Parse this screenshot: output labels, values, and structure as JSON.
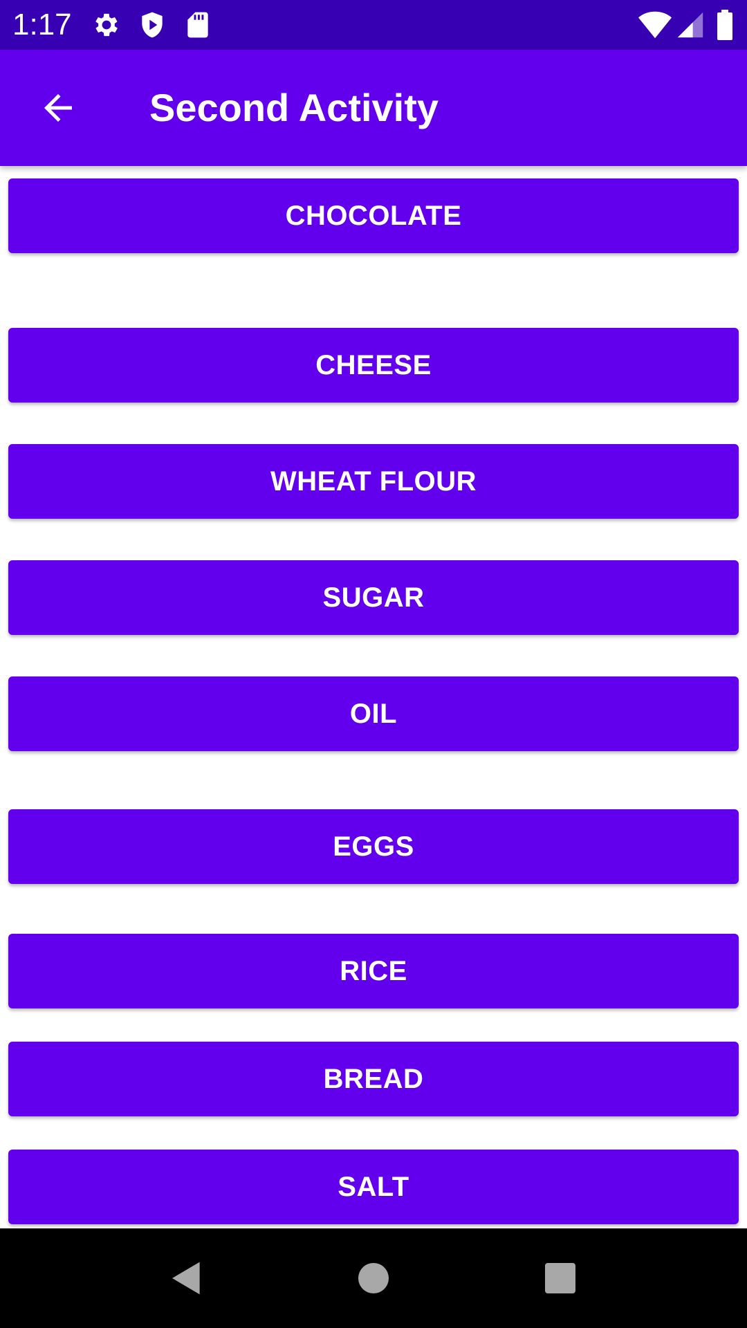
{
  "status_bar": {
    "time": "1:17",
    "background": "#3700b3",
    "left_icons": [
      "gear-icon",
      "shield-play-icon",
      "sd-card-icon"
    ],
    "right_icons": [
      "wifi-icon",
      "cell-signal-icon",
      "battery-icon"
    ]
  },
  "app_bar": {
    "title": "Second Activity",
    "background": "#6200ee",
    "back_icon": "arrow-back-icon"
  },
  "buttons": [
    "CHOCOLATE",
    "CHEESE",
    "WHEAT FLOUR",
    "SUGAR",
    "OIL",
    "EGGS",
    "RICE",
    "BREAD",
    "SALT"
  ],
  "button_color": "#6200ee",
  "nav_bar": {
    "background": "#000000",
    "icons": [
      "back-triangle-icon",
      "home-circle-icon",
      "recents-square-icon"
    ]
  }
}
